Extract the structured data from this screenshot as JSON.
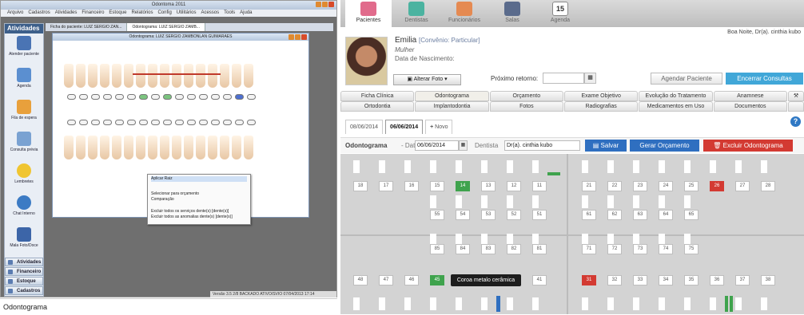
{
  "left_app": {
    "title": "Odontoma 2011",
    "menu": [
      "Arquivo",
      "Cadastros",
      "Atividades",
      "Financeiro",
      "Estoque",
      "Relatórios",
      "Config",
      "Utilitários",
      "Acessos",
      "Tools",
      "Ajuda"
    ],
    "sidebar_header": "Atividades",
    "sidebar_items": [
      "Atender paciente",
      "Agenda",
      "Fila de espera",
      "Consulta prévia",
      "Lembretes",
      "Chat Interno",
      "Mala Foto/Doce"
    ],
    "sidebar_bars": [
      "Atividades",
      "Financeiro",
      "Estoque",
      "Cadastros"
    ],
    "doc_tabs": [
      "Ficha do paciente: LUIZ SERGIO ZAN...",
      "Odontograma: LUIZ SERGIO ZAMB..."
    ],
    "inner_title": "Odontograma: LUIZ SERGIO ZAMBONLAN GUIMARAES",
    "context_menu": [
      "Aplicar Raiz",
      "",
      "",
      "Selecionar para orçamento",
      "Comparação",
      "Excluir todos os serviços dente(s) [dente(s)]",
      "Excluir todos as anomalias dente(s) [dente(s)]"
    ],
    "status": "Versão 3.5 2/8  BACKADO  ATIVO/SVIO  07/04/2013  17:14",
    "footer": "Odontograma"
  },
  "right_app": {
    "nav": [
      "Pacientes",
      "Dentistas",
      "Funcionários",
      "Salas",
      "Agenda"
    ],
    "agenda_day": "15",
    "greeting": "Boa Noite, Dr(a). cinthia kubo",
    "patient": {
      "name": "Emilia",
      "convenio": "[Convênio: Particular]",
      "gender": "Mulher",
      "birth_label": "Data de Nascimento:"
    },
    "alterar_foto": "Alterar Foto",
    "proximo_retorno": "Próximo retorno:",
    "agendar": "Agendar Paciente",
    "encerrar": "Encerrar Consultas",
    "tabs_row1": [
      "Ficha Clínica",
      "Odontograma",
      "Orçamento",
      "Exame Objetivo",
      "Evolução do Tratamento",
      "Anamnese"
    ],
    "tabs_row2": [
      "Ortodontia",
      "Implantodontia",
      "Fotos",
      "Radiografias",
      "Medicamentos em Uso",
      "Documentos"
    ],
    "subtabs": [
      "08/06/2014",
      "06/06/2014",
      "Novo"
    ],
    "odontograma_label": "Odontograma",
    "data_label": "- Data",
    "data_value": "06/06/2014",
    "dentista_label": "Dentista",
    "dentista_value": "Dr(a). cinthia kubo",
    "btn_salvar": "Salvar",
    "btn_orcamento": "Gerar Orçamento",
    "btn_excluir": "Excluir Odontograma",
    "upper_perm": [
      "18",
      "17",
      "16",
      "15",
      "14",
      "13",
      "12",
      "11",
      "21",
      "22",
      "23",
      "24",
      "25",
      "26",
      "27",
      "28"
    ],
    "upper_dec": [
      "55",
      "54",
      "53",
      "52",
      "51",
      "61",
      "62",
      "63",
      "64",
      "65"
    ],
    "lower_dec": [
      "85",
      "84",
      "83",
      "82",
      "81",
      "71",
      "72",
      "73",
      "74",
      "75"
    ],
    "lower_perm": [
      "48",
      "47",
      "46",
      "45",
      "44",
      "43",
      "42",
      "41",
      "31",
      "32",
      "33",
      "34",
      "35",
      "36",
      "37",
      "38"
    ],
    "tooltip": "Coroa metalo cerâmica",
    "colors": {
      "green": "#3fa34d",
      "red": "#d33a32",
      "blue": "#2f6fc0"
    }
  }
}
